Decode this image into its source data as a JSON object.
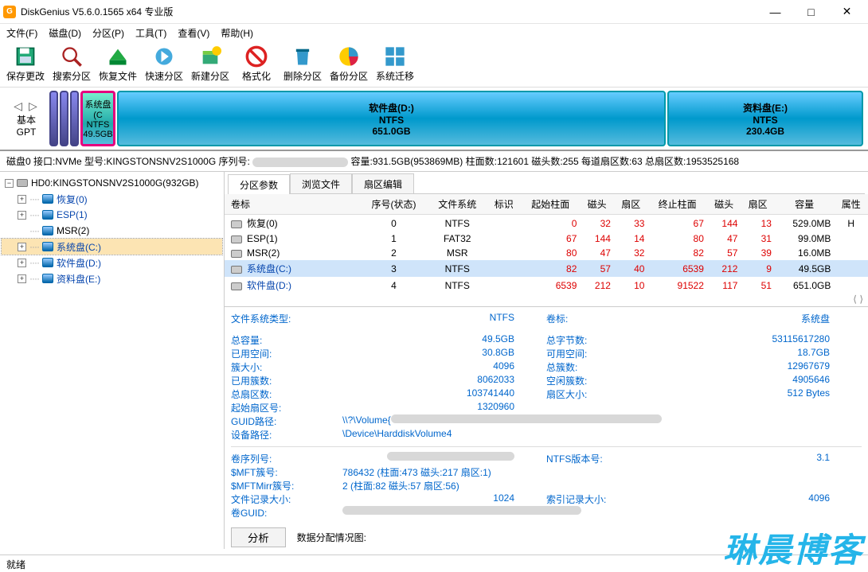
{
  "titlebar": {
    "title": "DiskGenius V5.6.0.1565 x64 专业版"
  },
  "menu": {
    "file": "文件(F)",
    "disk": "磁盘(D)",
    "partition": "分区(P)",
    "tools": "工具(T)",
    "view": "查看(V)",
    "help": "帮助(H)"
  },
  "toolbar": {
    "save": "保存更改",
    "search": "搜索分区",
    "recover": "恢复文件",
    "quick": "快速分区",
    "new": "新建分区",
    "format": "格式化",
    "delete": "删除分区",
    "backup": "备份分区",
    "migrate": "系统迁移"
  },
  "diskmap": {
    "nav_basic": "基本",
    "nav_scheme": "GPT",
    "sel": {
      "line1": "系统盘(C",
      "line2": "NTFS",
      "line3": "49.5GB"
    },
    "d": {
      "line1": "软件盘(D:)",
      "line2": "NTFS",
      "line3": "651.0GB"
    },
    "e": {
      "line1": "资料盘(E:)",
      "line2": "NTFS",
      "line3": "230.4GB"
    }
  },
  "diskinfo": {
    "prefix": "磁盘0 接口:NVMe 型号:KINGSTONSNV2S1000G 序列号:",
    "after": " 容量:931.5GB(953869MB) 柱面数:121601 磁头数:255 每道扇区数:63 总扇区数:1953525168"
  },
  "tree": {
    "root": "HD0:KINGSTONSNV2S1000G(932GB)",
    "items": [
      {
        "label": "恢复(0)"
      },
      {
        "label": "ESP(1)"
      },
      {
        "label": "MSR(2)"
      },
      {
        "label": "系统盘(C:)"
      },
      {
        "label": "软件盘(D:)"
      },
      {
        "label": "资料盘(E:)"
      }
    ]
  },
  "tabs": {
    "parm": "分区参数",
    "browse": "浏览文件",
    "sector": "扇区编辑"
  },
  "ptable": {
    "headers": [
      "卷标",
      "序号(状态)",
      "文件系统",
      "标识",
      "起始柱面",
      "磁头",
      "扇区",
      "终止柱面",
      "磁头",
      "扇区",
      "容量",
      "属性"
    ],
    "rows": [
      {
        "label": "恢复(0)",
        "seq": "0",
        "fs": "NTFS",
        "sc": "0",
        "sh": "32",
        "ss": "33",
        "ec": "67",
        "eh": "144",
        "es": "13",
        "cap": "529.0MB",
        "attr": "H"
      },
      {
        "label": "ESP(1)",
        "seq": "1",
        "fs": "FAT32",
        "sc": "67",
        "sh": "144",
        "ss": "14",
        "ec": "80",
        "eh": "47",
        "es": "31",
        "cap": "99.0MB",
        "attr": ""
      },
      {
        "label": "MSR(2)",
        "seq": "2",
        "fs": "MSR",
        "sc": "80",
        "sh": "47",
        "ss": "32",
        "ec": "82",
        "eh": "57",
        "es": "39",
        "cap": "16.0MB",
        "attr": ""
      },
      {
        "label": "系统盘(C:)",
        "seq": "3",
        "fs": "NTFS",
        "sc": "82",
        "sh": "57",
        "ss": "40",
        "ec": "6539",
        "eh": "212",
        "es": "9",
        "cap": "49.5GB",
        "attr": ""
      },
      {
        "label": "软件盘(D:)",
        "seq": "4",
        "fs": "NTFS",
        "sc": "6539",
        "sh": "212",
        "ss": "10",
        "ec": "91522",
        "eh": "117",
        "es": "51",
        "cap": "651.0GB",
        "attr": ""
      }
    ]
  },
  "detail": {
    "fs_type_lab": "文件系统类型:",
    "fs_type_val": "NTFS",
    "vol_label_lab": "卷标:",
    "vol_label_val": "系统盘",
    "total_lab": "总容量:",
    "total_val": "49.5GB",
    "bytes_lab": "总字节数:",
    "bytes_val": "53115617280",
    "used_lab": "已用空间:",
    "used_val": "30.8GB",
    "free_lab": "可用空间:",
    "free_val": "18.7GB",
    "cluster_lab": "簇大小:",
    "cluster_val": "4096",
    "total_clusters_lab": "总簇数:",
    "total_clusters_val": "12967679",
    "used_clusters_lab": "已用簇数:",
    "used_clusters_val": "8062033",
    "free_clusters_lab": "空闲簇数:",
    "free_clusters_val": "4905646",
    "total_sectors_lab": "总扇区数:",
    "total_sectors_val": "103741440",
    "sector_size_lab": "扇区大小:",
    "sector_size_val": "512 Bytes",
    "start_sector_lab": "起始扇区号:",
    "start_sector_val": "1320960",
    "guid_path_lab": "GUID路径:",
    "guid_path_val": "\\\\?\\Volume{",
    "dev_path_lab": "设备路径:",
    "dev_path_val": "\\Device\\HarddiskVolume4",
    "vol_serial_lab": "卷序列号:",
    "ntfs_ver_lab": "NTFS版本号:",
    "ntfs_ver_val": "3.1",
    "mft_lab": "$MFT簇号:",
    "mft_val": "786432 (柱面:473 磁头:217 扇区:1)",
    "mftmirr_lab": "$MFTMirr簇号:",
    "mftmirr_val": "2 (柱面:82 磁头:57 扇区:56)",
    "file_rec_lab": "文件记录大小:",
    "file_rec_val": "1024",
    "index_rec_lab": "索引记录大小:",
    "index_rec_val": "4096",
    "vol_guid_lab": "卷GUID:",
    "analyse_btn": "分析",
    "analyse_lab": "数据分配情况图:"
  },
  "statusbar": {
    "ready": "就绪"
  },
  "watermark": "琳晨博客"
}
